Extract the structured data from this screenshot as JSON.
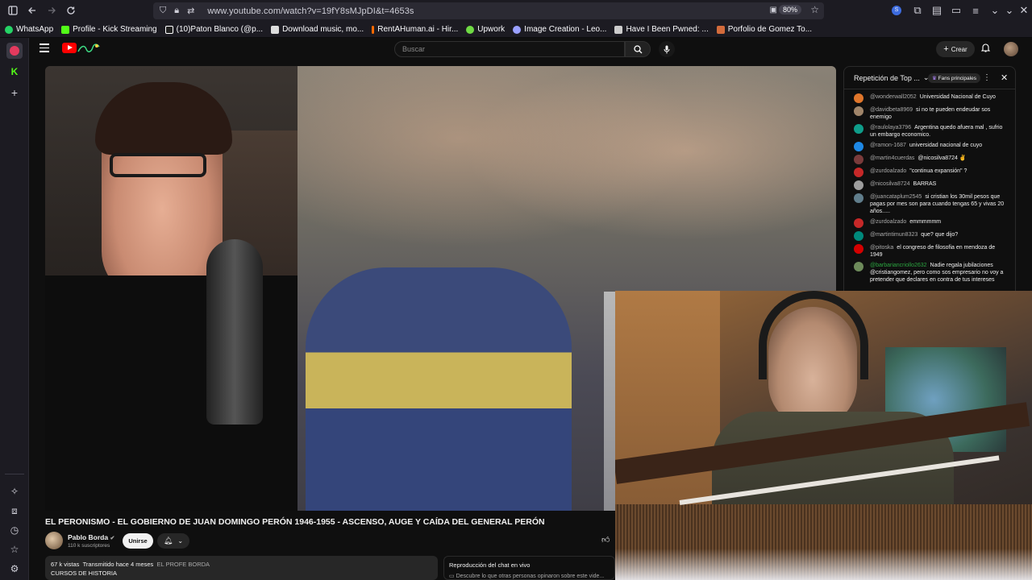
{
  "browser": {
    "url": "www.youtube.com/watch?v=19fY8sMJpDI&t=4653s",
    "zoom": "80%",
    "bookmarks": [
      {
        "label": "WhatsApp",
        "color": "#25d366"
      },
      {
        "label": "Profile - Kick Streaming",
        "color": "#53fc18"
      },
      {
        "label": "(10)Paton Blanco (@p...",
        "color": "#ffffff"
      },
      {
        "label": "Download music, mo...",
        "color": "#dddddd"
      },
      {
        "label": "RentAHuman.ai - Hir...",
        "color": "#ff6a00"
      },
      {
        "label": "Upwork",
        "color": "#6fda44"
      },
      {
        "label": "Image Creation - Leo...",
        "color": "#9aa0ff"
      },
      {
        "label": "Have I Been Pwned: ...",
        "color": "#cccccc"
      },
      {
        "label": "Porfolio de Gomez To...",
        "color": "#d36b3b"
      }
    ]
  },
  "header": {
    "search_placeholder": "Buscar",
    "create_label": "Crear"
  },
  "chat": {
    "title": "Repetición de Top ...",
    "badge": "Fans principales",
    "messages": [
      {
        "author": "@wonderwall2052",
        "text": "Universidad Nacional de Cuyo",
        "color": "#e0762b",
        "green": false
      },
      {
        "author": "@davidbeta8969",
        "text": "si no te pueden endeudar sos enemigo",
        "color": "#a0856a",
        "green": false
      },
      {
        "author": "@raulolaya3796",
        "text": "Argentina quedo afuera mal , sufrio un embargo economico.",
        "color": "#0f9d8a",
        "green": false
      },
      {
        "author": "@ramon-1687",
        "text": "universidad nacional de cuyo",
        "color": "#1e88e5",
        "green": false
      },
      {
        "author": "@martin4cuerdas",
        "text": "@nicosilva8724 ✌",
        "color": "#7a3b3b",
        "green": false
      },
      {
        "author": "@zurdoalzado",
        "text": "\"continua expansión\" ?",
        "color": "#c62828",
        "green": false
      },
      {
        "author": "@nicosilva8724",
        "text": "BARRAS",
        "color": "#9e9e9e",
        "green": false
      },
      {
        "author": "@juancataplum2545",
        "text": "si cristian los 30mil pesos que pagas por mes son para cuando tengas 65 y vivas 20 años.....",
        "color": "#607d8b",
        "green": false
      },
      {
        "author": "@zurdoalzado",
        "text": "emmmmmm",
        "color": "#c62828",
        "green": false
      },
      {
        "author": "@martintimun8323",
        "text": "que? que dijo?",
        "color": "#00897b",
        "green": false
      },
      {
        "author": "@pitoska",
        "text": "el congreso de filosofia en mendoza de 1949",
        "color": "#d50000",
        "green": false
      },
      {
        "author": "@barbariancriollo2632",
        "text": "Nadie regala jubilaciones @cristiangomez, pero como sos empresario no voy a pretender que declares en contra de tus intereses",
        "color": "#6d8a5a",
        "green": true
      }
    ]
  },
  "video": {
    "title": "EL PERONISMO - EL GOBIERNO DE JUAN DOMINGO PERÓN 1946-1955 - ASCENSO, AUGE Y CAÍDA DEL GENERAL PERÓN",
    "channel": "Pablo Borda",
    "subscribers": "110 k suscriptores",
    "join_label": "Unirse",
    "views": "67 k vistas",
    "streamed": "Transmitido hace 4 meses",
    "hashtag": "EL PROFE BORDA",
    "playlist": "CURSOS DE HISTORIA",
    "replay_label": "Reproducción del chat en vivo",
    "replay_sub": "Descubre lo que otras personas opinaron sobre este vide..."
  }
}
